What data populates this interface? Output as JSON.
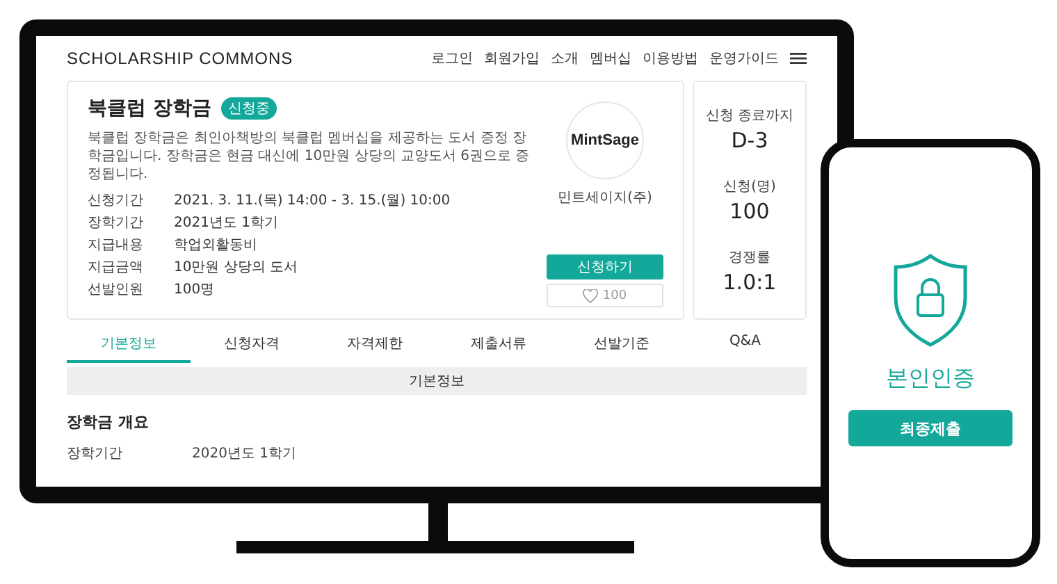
{
  "header": {
    "logo": "SCHOLARSHIP COMMONS",
    "nav": [
      "로그인",
      "회원가입",
      "소개",
      "멤버십",
      "이용방법",
      "운영가이드"
    ]
  },
  "scholarship": {
    "title": "북클럽 장학금",
    "badge": "신청중",
    "description": "북클럽 장학금은 최인아책방의 북클럽 멤버십을 제공하는 도서 증정 장학금입니다. 장학금은 현금 대신에 10만원 상당의 교양도서 6권으로 증정됩니다.",
    "details": [
      {
        "label": "신청기간",
        "value": "2021. 3. 11.(목) 14:00 - 3. 15.(월) 10:00"
      },
      {
        "label": "장학기간",
        "value": "2021년도 1학기"
      },
      {
        "label": "지급내용",
        "value": "학업외활동비"
      },
      {
        "label": "지급금액",
        "value": "10만원 상당의 도서"
      },
      {
        "label": "선발인원",
        "value": "100명"
      }
    ],
    "sponsor": {
      "logo": "MintSage",
      "name": "민트세이지(주)"
    },
    "apply_button": "신청하기",
    "likes": "100"
  },
  "stats": [
    {
      "label": "신청 종료까지",
      "value": "D-3"
    },
    {
      "label": "신청(명)",
      "value": "100"
    },
    {
      "label": "경쟁률",
      "value": "1.0:1"
    }
  ],
  "tabs": [
    {
      "label": "기본정보",
      "selected": true
    },
    {
      "label": "신청자격",
      "selected": false
    },
    {
      "label": "자격제한",
      "selected": false
    },
    {
      "label": "제출서류",
      "selected": false
    },
    {
      "label": "선발기준",
      "selected": false
    },
    {
      "label": "Q&A",
      "selected": false
    }
  ],
  "section_bar": "기본정보",
  "overview": {
    "title": "장학금 개요",
    "rows": [
      {
        "label": "장학기간",
        "value": "2020년도 1학기"
      }
    ]
  },
  "phone": {
    "title": "본인인증",
    "button": "최종제출"
  }
}
